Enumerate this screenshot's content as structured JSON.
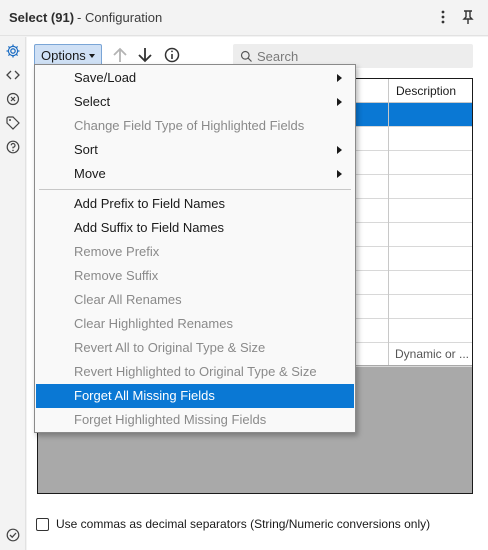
{
  "titlebar": {
    "title": "Select (91)",
    "subtitle": "- Configuration",
    "more_icon": "more-vertical-icon",
    "pin_icon": "pin-icon"
  },
  "sidebar": {
    "items": [
      {
        "icon": "gear-icon",
        "active": true
      },
      {
        "icon": "code-icon"
      },
      {
        "icon": "target-icon"
      },
      {
        "icon": "tag-icon"
      },
      {
        "icon": "help-icon"
      }
    ],
    "bottom_icon": "check-circle-icon"
  },
  "toolbar": {
    "options_label": "Options",
    "up_icon": "arrow-up-icon",
    "down_icon": "arrow-down-icon",
    "info_icon": "info-icon"
  },
  "search": {
    "placeholder": "Search",
    "value": ""
  },
  "grid": {
    "column_header": "Description",
    "rows": [
      {
        "desc": "",
        "selected": true
      },
      {
        "desc": ""
      },
      {
        "desc": ""
      },
      {
        "desc": ""
      },
      {
        "desc": ""
      },
      {
        "desc": ""
      },
      {
        "desc": ""
      },
      {
        "desc": ""
      },
      {
        "desc": ""
      },
      {
        "desc": ""
      },
      {
        "desc": "Dynamic or ..."
      }
    ]
  },
  "menu": {
    "items": [
      {
        "label": "Save/Load",
        "submenu": true
      },
      {
        "label": "Select",
        "submenu": true
      },
      {
        "label": "Change Field Type of Highlighted Fields",
        "disabled": true
      },
      {
        "label": "Sort",
        "submenu": true
      },
      {
        "label": "Move",
        "submenu": true
      },
      {
        "separator": true
      },
      {
        "label": "Add Prefix to Field Names"
      },
      {
        "label": "Add Suffix to Field Names"
      },
      {
        "label": "Remove Prefix",
        "disabled": true
      },
      {
        "label": "Remove Suffix",
        "disabled": true
      },
      {
        "label": "Clear All Renames",
        "disabled": true
      },
      {
        "label": "Clear Highlighted Renames",
        "disabled": true
      },
      {
        "label": "Revert All to Original Type & Size",
        "disabled": true
      },
      {
        "label": "Revert Highlighted to Original Type & Size",
        "disabled": true
      },
      {
        "label": "Forget All Missing Fields",
        "highlighted": true
      },
      {
        "label": "Forget Highlighted Missing Fields",
        "disabled": true
      }
    ]
  },
  "footer": {
    "decimal_label": "Use commas as decimal separators (String/Numeric conversions only)",
    "decimal_checked": false
  },
  "colors": {
    "accent": "#0a78d4",
    "options_bg": "#cfe0f5",
    "disabled_text": "#8a8a8a"
  }
}
